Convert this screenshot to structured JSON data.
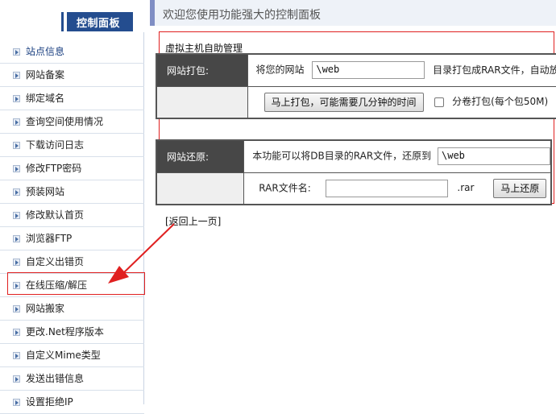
{
  "sidebar": {
    "title": "控制面板",
    "items": [
      {
        "label": "站点信息"
      },
      {
        "label": "网站备案"
      },
      {
        "label": "绑定域名"
      },
      {
        "label": "查询空间使用情况"
      },
      {
        "label": "下载访问日志"
      },
      {
        "label": "修改FTP密码"
      },
      {
        "label": "预装网站"
      },
      {
        "label": "修改默认首页"
      },
      {
        "label": "浏览器FTP"
      },
      {
        "label": "自定义出错页"
      },
      {
        "label": "在线压缩/解压"
      },
      {
        "label": "网站搬家"
      },
      {
        "label": "更改.Net程序版本"
      },
      {
        "label": "自定义Mime类型"
      },
      {
        "label": "发送出错信息"
      },
      {
        "label": "设置拒绝IP"
      }
    ]
  },
  "header": {
    "welcome": "欢迎您使用功能强大的控制面板"
  },
  "pack": {
    "caption": "虚拟主机自助管理",
    "label": "网站打包:",
    "prefix": "将您的网站",
    "path_value": "\\web",
    "suffix": "目录打包成RAR文件，自动放",
    "button": "马上打包，可能需要几分钟的时间",
    "split_label": "分卷打包(每个包50M)"
  },
  "restore": {
    "label": "网站还原:",
    "text": "本功能可以将DB目录的RAR文件，还原到",
    "path_value": "\\web",
    "rar_label": "RAR文件名:",
    "rar_value": "",
    "ext": ".rar",
    "button": "马上还原"
  },
  "back_link": "[返回上一页]",
  "colors": {
    "accent": "#244d8f",
    "highlight": "#e02020",
    "label_bg": "#474747"
  }
}
